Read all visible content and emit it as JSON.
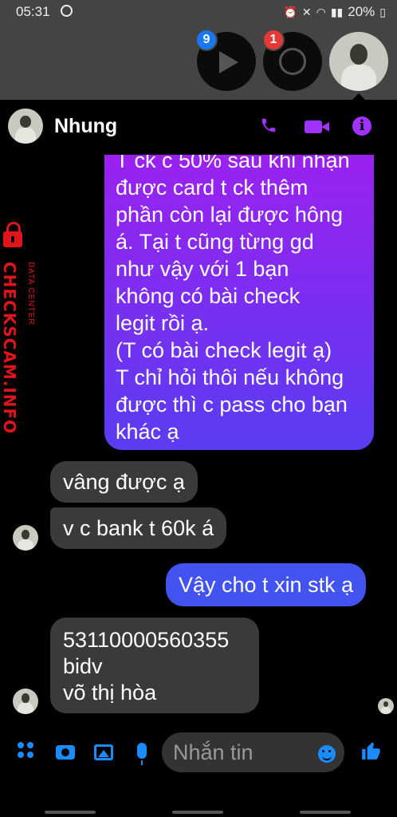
{
  "status_bar": {
    "time": "05:31",
    "battery": "20%"
  },
  "chat_heads": {
    "video_badge": "9",
    "messenger_badge": "1"
  },
  "header": {
    "contact_name": "Nhung"
  },
  "colors": {
    "accent": "#a033ff",
    "outgoing_top": "#a01ff0",
    "outgoing_bottom": "#5a3cf2",
    "incoming": "#3a3a3a",
    "composer_icons": "#1a8cff",
    "watermark": "#e0151b"
  },
  "messages": {
    "outgoing_long": "T ck c 50% sau khi nhận\nđược card t ck thêm\nphần còn lại được hông\ná. Tại t cũng từng gd\nnhư vậy với 1 bạn\nkhông có bài check\nlegit rồi ạ.\n(T có bài check legit ạ)\nT chỉ hỏi thôi nếu không\nđược thì c pass cho bạn\nkhác ạ",
    "incoming_1": "vâng được ạ",
    "incoming_2": "v c bank t 60k á",
    "outgoing_short": "Vậy cho t xin stk ạ",
    "incoming_3": "53110000560355\nbidv\nvõ thị hòa"
  },
  "watermark": {
    "brand": "CHECKSCAM.INFO",
    "sub": "DATA CENTER"
  },
  "composer": {
    "placeholder": "Nhắn tin"
  },
  "icons": [
    "messenger-status-icon",
    "alarm-icon",
    "mute-icon",
    "wifi-icon",
    "signal-icon",
    "battery-icon",
    "play-icon",
    "messenger-icon",
    "phone-icon",
    "video-call-icon",
    "info-icon",
    "lock-icon",
    "grid-menu-icon",
    "camera-icon",
    "image-icon",
    "mic-icon",
    "emoji-icon",
    "like-icon"
  ]
}
